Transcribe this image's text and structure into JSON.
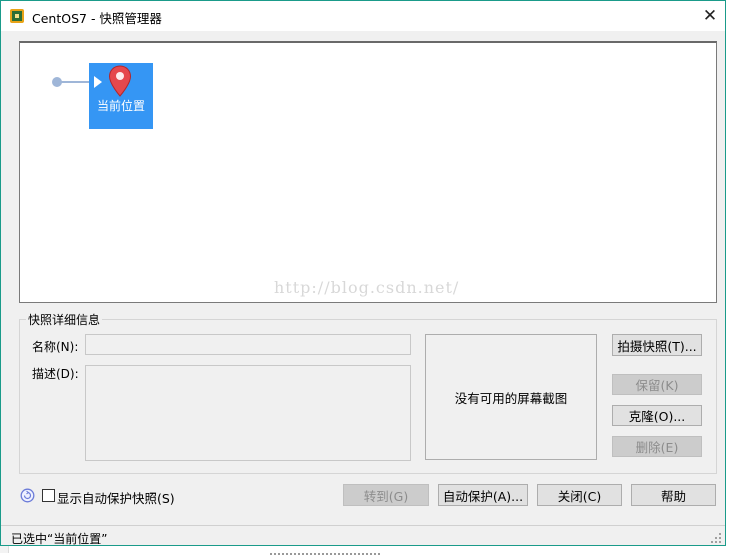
{
  "window": {
    "title": "CentOS7 - 快照管理器",
    "close_glyph": "✕"
  },
  "tree": {
    "current_node_label": "当前位置",
    "watermark": "http://blog.csdn.net/"
  },
  "details": {
    "group_label": "快照详细信息",
    "name_label": "名称(N):",
    "name_value": "",
    "desc_label": "描述(D):",
    "desc_value": "",
    "screenshot_placeholder": "没有可用的屏幕截图"
  },
  "buttons": {
    "take_snapshot": "拍摄快照(T)...",
    "keep": "保留(K)",
    "clone": "克隆(O)...",
    "delete": "删除(E)",
    "goto": "转到(G)",
    "autoprotect": "自动保护(A)...",
    "close": "关闭(C)",
    "help": "帮助"
  },
  "options": {
    "show_autoprotect_label": "显示自动保护快照(S)",
    "show_autoprotect_checked": false
  },
  "status": {
    "text": "已选中“当前位置”"
  },
  "colors": {
    "accent_border": "#1a9b8a",
    "selected_node": "#3596f4",
    "pin": "#e5484d"
  },
  "icons": {
    "app": "vmware-workstation-icon",
    "pin": "map-pin-icon",
    "restore": "restore-circle-icon"
  }
}
